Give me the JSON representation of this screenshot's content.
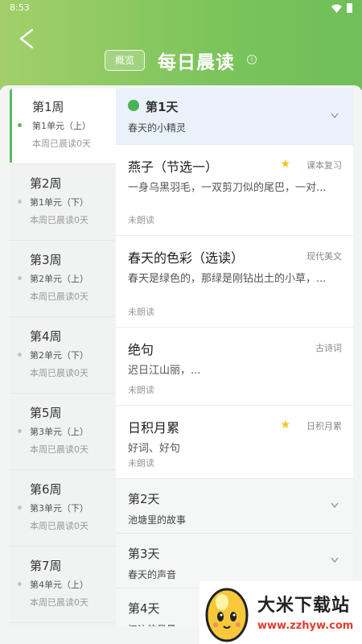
{
  "status_bar": {
    "time": "8:53"
  },
  "header": {
    "overview_label": "概览",
    "title": "每日晨读",
    "info_glyph": "i"
  },
  "weeks": [
    {
      "title": "第1周",
      "unit": "第1单元（上）",
      "status": "本周已晨读0天",
      "active": true
    },
    {
      "title": "第2周",
      "unit": "第1单元（下）",
      "status": "本周已晨读0天",
      "active": false
    },
    {
      "title": "第3周",
      "unit": "第2单元（上）",
      "status": "本周已晨读0天",
      "active": false
    },
    {
      "title": "第4周",
      "unit": "第2单元（下）",
      "status": "本周已晨读0天",
      "active": false
    },
    {
      "title": "第5周",
      "unit": "第3单元（上）",
      "status": "本周已晨读0天",
      "active": false
    },
    {
      "title": "第6周",
      "unit": "第3单元（下）",
      "status": "本周已晨读0天",
      "active": false
    },
    {
      "title": "第7周",
      "unit": "第4单元（上）",
      "status": "本周已晨读0天",
      "active": false
    }
  ],
  "days": [
    {
      "title": "第1天",
      "subtitle": "春天的小精灵",
      "expanded": true,
      "lessons": [
        {
          "title": "燕子（节选一）",
          "tag": "课本复习",
          "starred": true,
          "desc": "一身乌黑羽毛，一双剪刀似的尾巴，一对...",
          "state": "未朗读"
        },
        {
          "title": "春天的色彩（选读）",
          "tag": "现代美文",
          "starred": false,
          "desc": "春天是绿色的，那绿是刚钻出土的小草，...",
          "state": "未朗读"
        },
        {
          "title": "绝句",
          "tag": "古诗词",
          "starred": false,
          "desc": "迟日江山丽，...",
          "state": "未朗读"
        },
        {
          "title": "日积月累",
          "tag": "日积月累",
          "starred": true,
          "desc": "好词、好句",
          "state": "未朗读"
        }
      ]
    },
    {
      "title": "第2天",
      "subtitle": "池塘里的故事",
      "expanded": false
    },
    {
      "title": "第3天",
      "subtitle": "春天的声音",
      "expanded": false
    },
    {
      "title": "第4天",
      "subtitle": "江边的风景",
      "expanded": false
    }
  ],
  "watermark": {
    "title": "大米下载站",
    "url": "www.zzhyw.com"
  },
  "colors": {
    "accent": "#5bb85d",
    "header_start": "#a3cf6a",
    "header_end": "#6fbf5a",
    "star": "#f3c21c"
  }
}
